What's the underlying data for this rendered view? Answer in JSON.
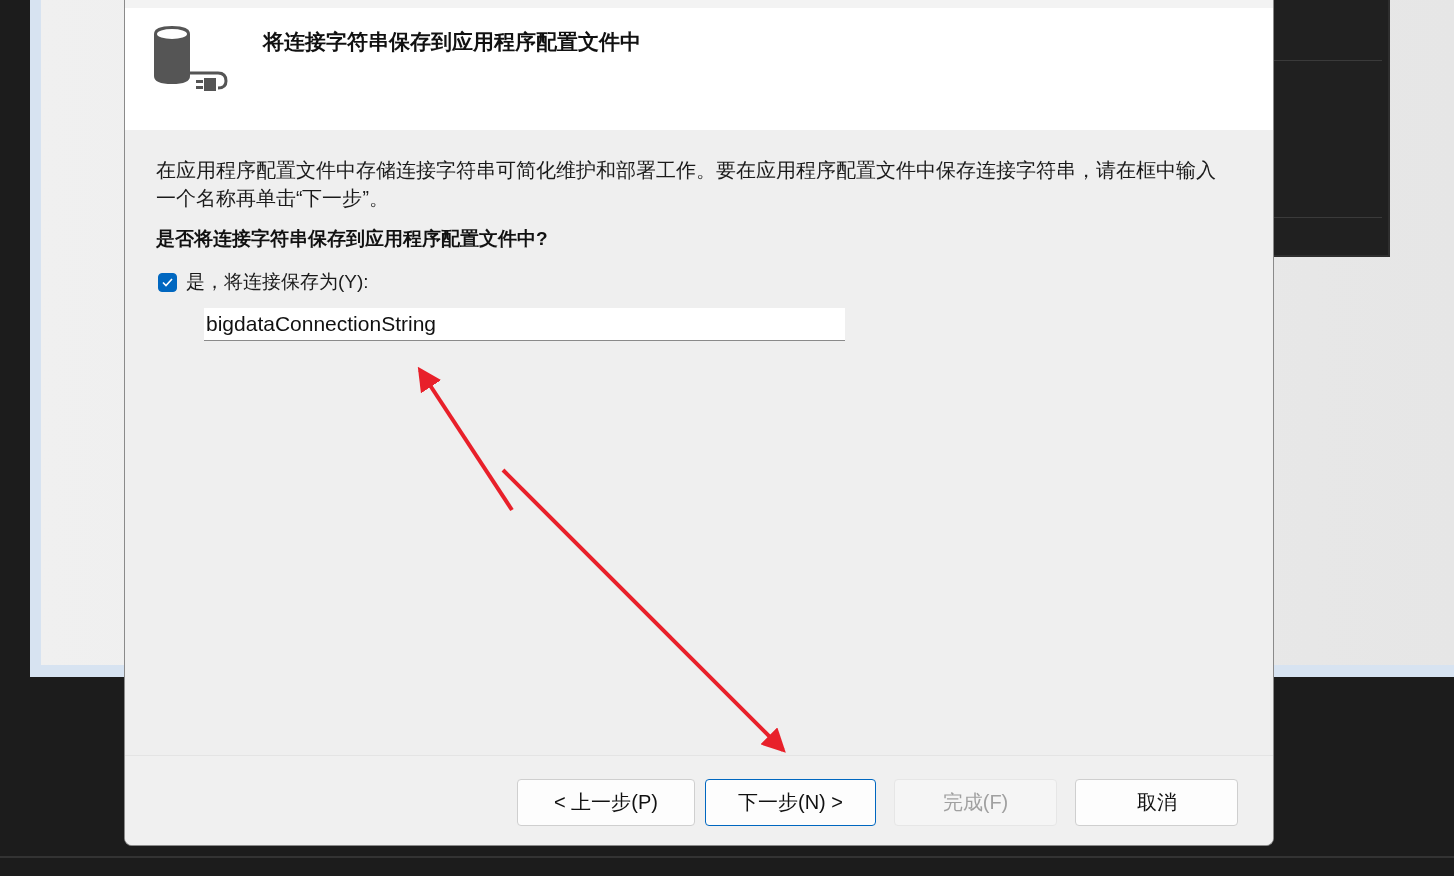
{
  "dialog": {
    "title": "将连接字符串保存到应用程序配置文件中",
    "description": "在应用程序配置文件中存储连接字符串可简化维护和部署工作。要在应用程序配置文件中保存连接字符串，请在框中输入一个名称再单击“下一步”。",
    "question": "是否将连接字符串保存到应用程序配置文件中?",
    "save_option": {
      "label": "是，将连接保存为(Y):",
      "checked": true
    },
    "connection_name": {
      "value": "bigdataConnectionString"
    },
    "buttons": [
      {
        "label": "< 上一步(P)",
        "disabled": false,
        "focused": false
      },
      {
        "label": "下一步(N) >",
        "disabled": false,
        "focused": true
      },
      {
        "label": "完成(F)",
        "disabled": true,
        "focused": false
      },
      {
        "label": "取消",
        "disabled": false,
        "focused": false
      }
    ]
  }
}
